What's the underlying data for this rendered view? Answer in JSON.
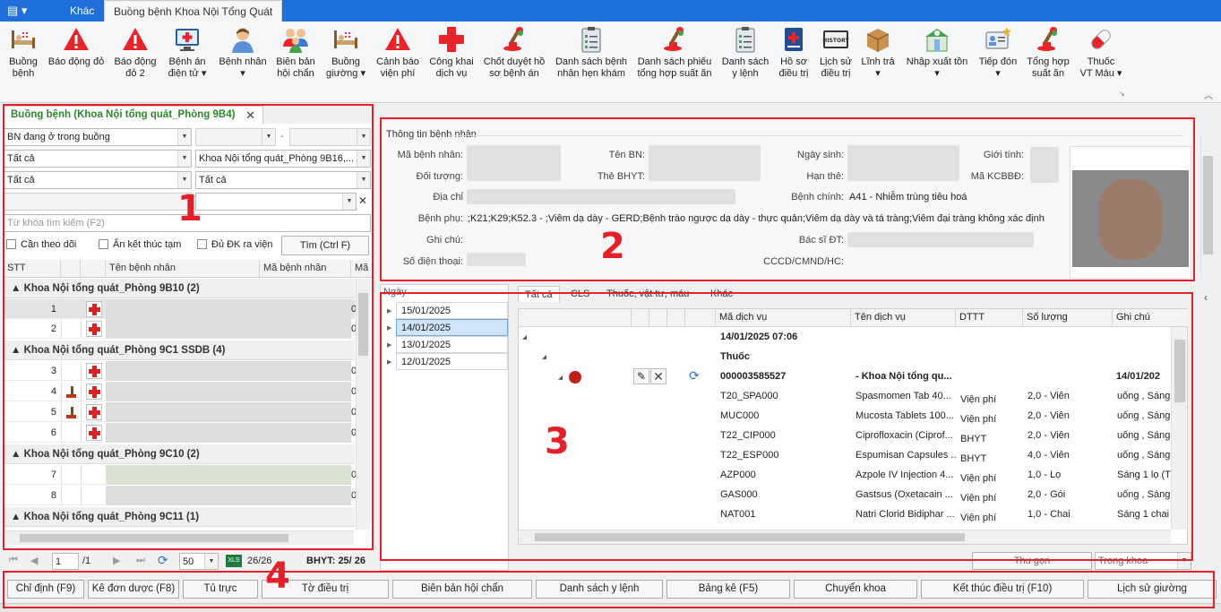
{
  "ribbon": {
    "tabs": [
      "Khác",
      "Buồng bệnh Khoa Nội Tổng Quát"
    ],
    "buttons": [
      {
        "label": "Buồng\nbệnh",
        "icon": "bed-icon"
      },
      {
        "label": "Báo động đỏ",
        "icon": "alert-icon"
      },
      {
        "label": "Báo động\nđỏ 2",
        "icon": "alert-icon"
      },
      {
        "label": "Bệnh án\nđiện tử ▾",
        "icon": "monitor-cross-icon"
      },
      {
        "label": "Bệnh nhân\n▾",
        "icon": "patient-icon"
      },
      {
        "label": "Biên bản\nhội chẩn",
        "icon": "group-icon"
      },
      {
        "label": "Buồng\ngiường ▾",
        "icon": "bed-icon"
      },
      {
        "label": "Cảnh báo\nviện phí",
        "icon": "alert-icon"
      },
      {
        "label": "Công khai\ndịch vụ",
        "icon": "red-cross-icon"
      },
      {
        "label": "Chốt duyệt hồ\nsơ bệnh án",
        "icon": "stamp-icon"
      },
      {
        "label": "Danh sách bệnh\nnhân hẹn khám",
        "icon": "clipboard-icon"
      },
      {
        "label": "Danh sách phiếu\ntổng hợp suất ăn",
        "icon": "stamp-icon"
      },
      {
        "label": "Danh sách\ny lệnh",
        "icon": "clipboard-icon"
      },
      {
        "label": "Hồ sơ\nđiều trị",
        "icon": "medical-book-icon"
      },
      {
        "label": "Lịch sử\nđiều trị",
        "icon": "history-icon"
      },
      {
        "label": "Lĩnh trả\n▾",
        "icon": "box-icon"
      },
      {
        "label": "Nhập xuất tồn\n▾",
        "icon": "pharmacy-icon"
      },
      {
        "label": "Tiếp đón\n▾",
        "icon": "id-card-icon"
      },
      {
        "label": "Tổng hợp\nsuất ăn",
        "icon": "stamp-icon"
      },
      {
        "label": "Thuốc\nVT Máu ▾",
        "icon": "capsule-icon"
      }
    ]
  },
  "left": {
    "tab_title": "Buồng bệnh (Khoa Nội tổng quát_Phòng 9B4)",
    "filter1": "BN đang ở trong buồng",
    "filter1_sep": "-",
    "filter2": "Tất cả",
    "filter2_dept": "Khoa Nội tổng quát_Phòng 9B16,...",
    "filter3": "Tất cả",
    "filter3_b": "Tất cả",
    "search_placeholder": "Từ khóa tìm kiếm (F2)",
    "chk1": "Cần theo dõi",
    "chk2": "Ẩn kết thúc tạm",
    "chk3": "Đủ ĐK ra viện",
    "find_button": "Tìm (Ctrl F)",
    "columns": [
      "STT",
      "Tên bệnh nhân",
      "Mã bệnh nhân",
      "Mã c"
    ],
    "groups": [
      {
        "name": "Khoa Nội tổng quát_Phòng 9B10 (2)",
        "rows": [
          {
            "stt": "1",
            "c": "0"
          },
          {
            "stt": "2",
            "c": "0"
          }
        ]
      },
      {
        "name": "Khoa Nội tổng quát_Phòng 9C1 SSDB (4)",
        "rows": [
          {
            "stt": "3",
            "c": "0"
          },
          {
            "stt": "4",
            "c": "0"
          },
          {
            "stt": "5",
            "c": "0"
          },
          {
            "stt": "6",
            "c": "0"
          }
        ]
      },
      {
        "name": "Khoa Nội tổng quát_Phòng 9C10 (2)",
        "rows": [
          {
            "stt": "7",
            "c": "0"
          },
          {
            "stt": "8",
            "c": "0"
          }
        ]
      },
      {
        "name": "Khoa Nội tổng quát_Phòng 9C11 (1)",
        "rows": []
      }
    ],
    "pager": {
      "page": "1",
      "total": "/1",
      "page_size": "50",
      "count": "26/26",
      "bhyt": "BHYT: 25/ 26"
    }
  },
  "info": {
    "section_title": "Thông tin bệnh nhân",
    "labels": {
      "ma_bn": "Mã bệnh nhân:",
      "ten_bn": "Tên BN:",
      "ngay_sinh": "Ngày sinh:",
      "gioi_tinh": "Giới tính:",
      "doi_tuong": "Đối tượng:",
      "the_bhyt": "Thẻ BHYT:",
      "han_the": "Hạn thẻ:",
      "ma_kcbbd": "Mã KCBBĐ:",
      "dia_chi": "Địa chỉ",
      "benh_chinh": "Bệnh chính:",
      "benh_phu": "Bệnh phụ:",
      "ghi_chu": "Ghi chú:",
      "bac_si": "Bác sĩ ĐT:",
      "so_dien_thoai": "Số điện thoại:",
      "cccd": "CCCD/CMND/HC:"
    },
    "benh_chinh_value": "A41 - Nhiễm trùng tiêu hoá",
    "benh_phu_value": ";K21;K29;K52.3 - ;Viêm dạ dày - GERD;Bệnh trào ngược dạ dày - thực quản;Viêm dạ dày và tá tràng;Viêm đại tràng không xác định"
  },
  "dates": {
    "header": "Ngày",
    "items": [
      "15/01/2025",
      "14/01/2025",
      "13/01/2025",
      "12/01/2025"
    ],
    "selected": 1
  },
  "detail": {
    "tabs": [
      "Tất cả",
      "CLS",
      "Thuốc, vật tư, máu",
      "Khác"
    ],
    "columns": [
      "Mã dịch vụ",
      "Tên dịch vụ",
      "DTTT",
      "Số lượng",
      "Ghi chú"
    ],
    "date_row": "14/01/2025 07:06",
    "group_row": "Thuốc",
    "order": {
      "code": "000003585527",
      "dept": "- Khoa Nội tổng qu...",
      "date": "14/01/202"
    },
    "rows": [
      {
        "ma": "T20_SPA000",
        "ten": "Spasmomen Tab 40...",
        "dttt": "Viện phí",
        "sl": "2,0 - Viên",
        "gc": "uống , Sáng"
      },
      {
        "ma": "MUC000",
        "ten": "Mucosta Tablets 100...",
        "dttt": "Viện phí",
        "sl": "2,0 - Viên",
        "gc": "uống , Sáng"
      },
      {
        "ma": "T22_CIP000",
        "ten": "Ciprofloxacin (Ciprof...",
        "dttt": "BHYT",
        "sl": "2,0 - Viên",
        "gc": "uống , Sáng"
      },
      {
        "ma": "T22_ESP000",
        "ten": "Espumisan Capsules ...",
        "dttt": "BHYT",
        "sl": "4,0 - Viên",
        "gc": "uống , Sáng"
      },
      {
        "ma": "AZP000",
        "ten": "Azpole IV Injection 4...",
        "dttt": "Viện phí",
        "sl": "1,0 - Lọ",
        "gc": "Sáng 1 lọ (TM"
      },
      {
        "ma": "GAS000",
        "ten": "Gastsus (Oxetacain ...",
        "dttt": "Viện phí",
        "sl": "2,0 - Gói",
        "gc": "uống , Sáng"
      },
      {
        "ma": "NAT001",
        "ten": "Natri Clorid Bidiphar ...",
        "dttt": "Viện phí",
        "sl": "1,0 - Chai",
        "gc": "Sáng 1 chai ("
      }
    ],
    "thu_gon": "Thu gọn",
    "trong_khoa": "Trong khoa"
  },
  "bottom_buttons": [
    "Chỉ định (F9)",
    "Kê đơn dược (F8)",
    "Tủ trực",
    "Tờ điều trị",
    "Biên bản hội chẩn",
    "Danh sách y lệnh",
    "Bảng kê (F5)",
    "Chuyển khoa",
    "Kết thúc điều trị (F10)",
    "Lịch sử giường"
  ],
  "annotations": [
    "1",
    "2",
    "3",
    "4"
  ],
  "colors": {
    "accent": "#1e6fd9",
    "annotation": "#e4202b",
    "tab_title": "#2a8a2a",
    "selection": "#cfe4f7"
  }
}
